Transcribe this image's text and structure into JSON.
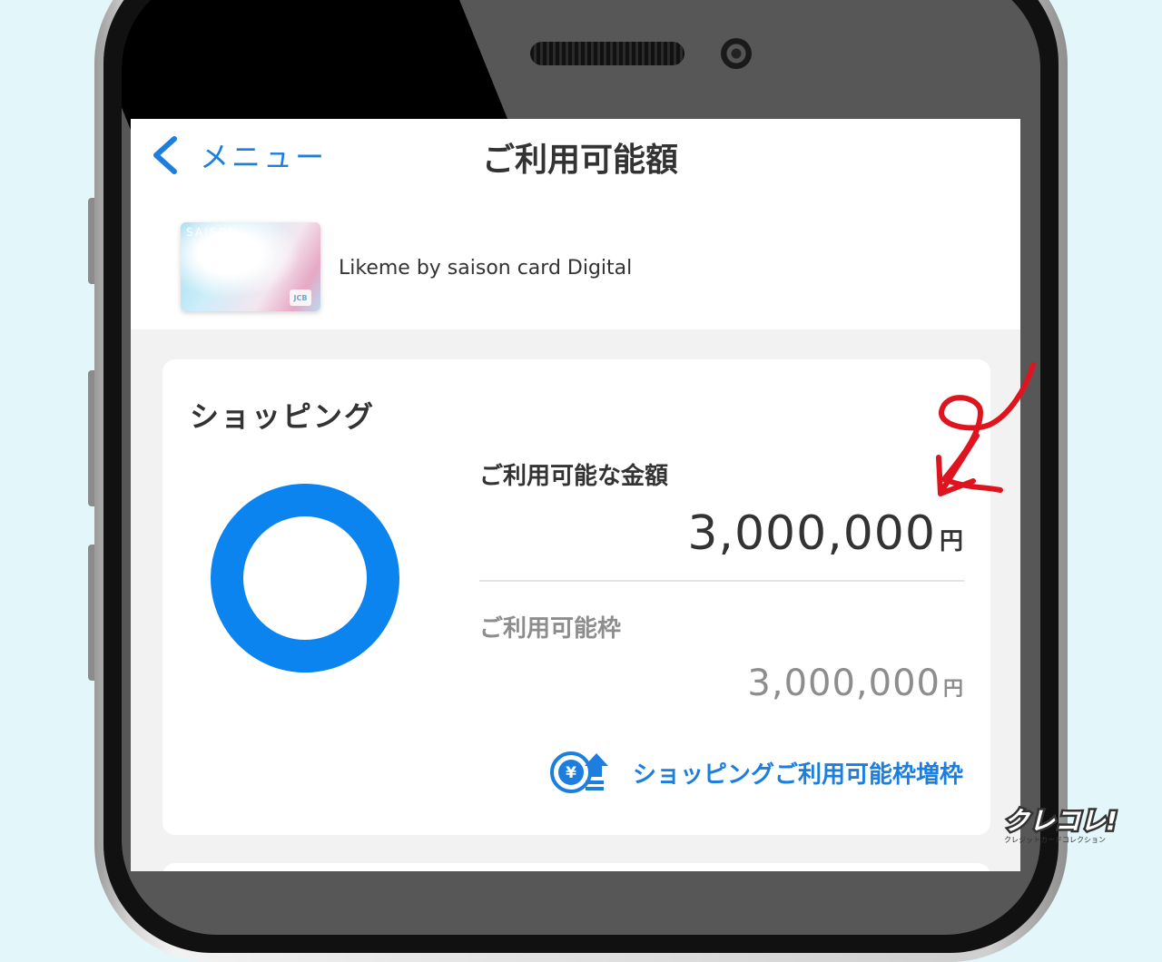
{
  "nav": {
    "back_label": "メニュー",
    "title": "ご利用可能額"
  },
  "card": {
    "brand_text": "SAISON",
    "network": "JCB",
    "name": "Likeme by saison card Digital"
  },
  "shopping": {
    "title": "ショッピング",
    "available_label": "ご利用可能な金額",
    "available_amount": "3,000,000",
    "available_unit": "円",
    "limit_label": "ご利用可能枠",
    "limit_amount": "3,000,000",
    "limit_unit": "円",
    "increase_link_label": "ショッピングご利用可能枠増枠",
    "usage_fraction_available": 1.0
  },
  "watermark": {
    "logo_text": "クレコレ!",
    "sub_text": "クレジットカードコレクション"
  },
  "colors": {
    "accent_blue": "#0b84f0",
    "link_blue": "#1c7fe0",
    "annotation_red": "#e0141e",
    "background": "#e3f7fb"
  },
  "icons": {
    "back": "chevron-left-icon",
    "increase": "yen-up-arrow-icon"
  }
}
